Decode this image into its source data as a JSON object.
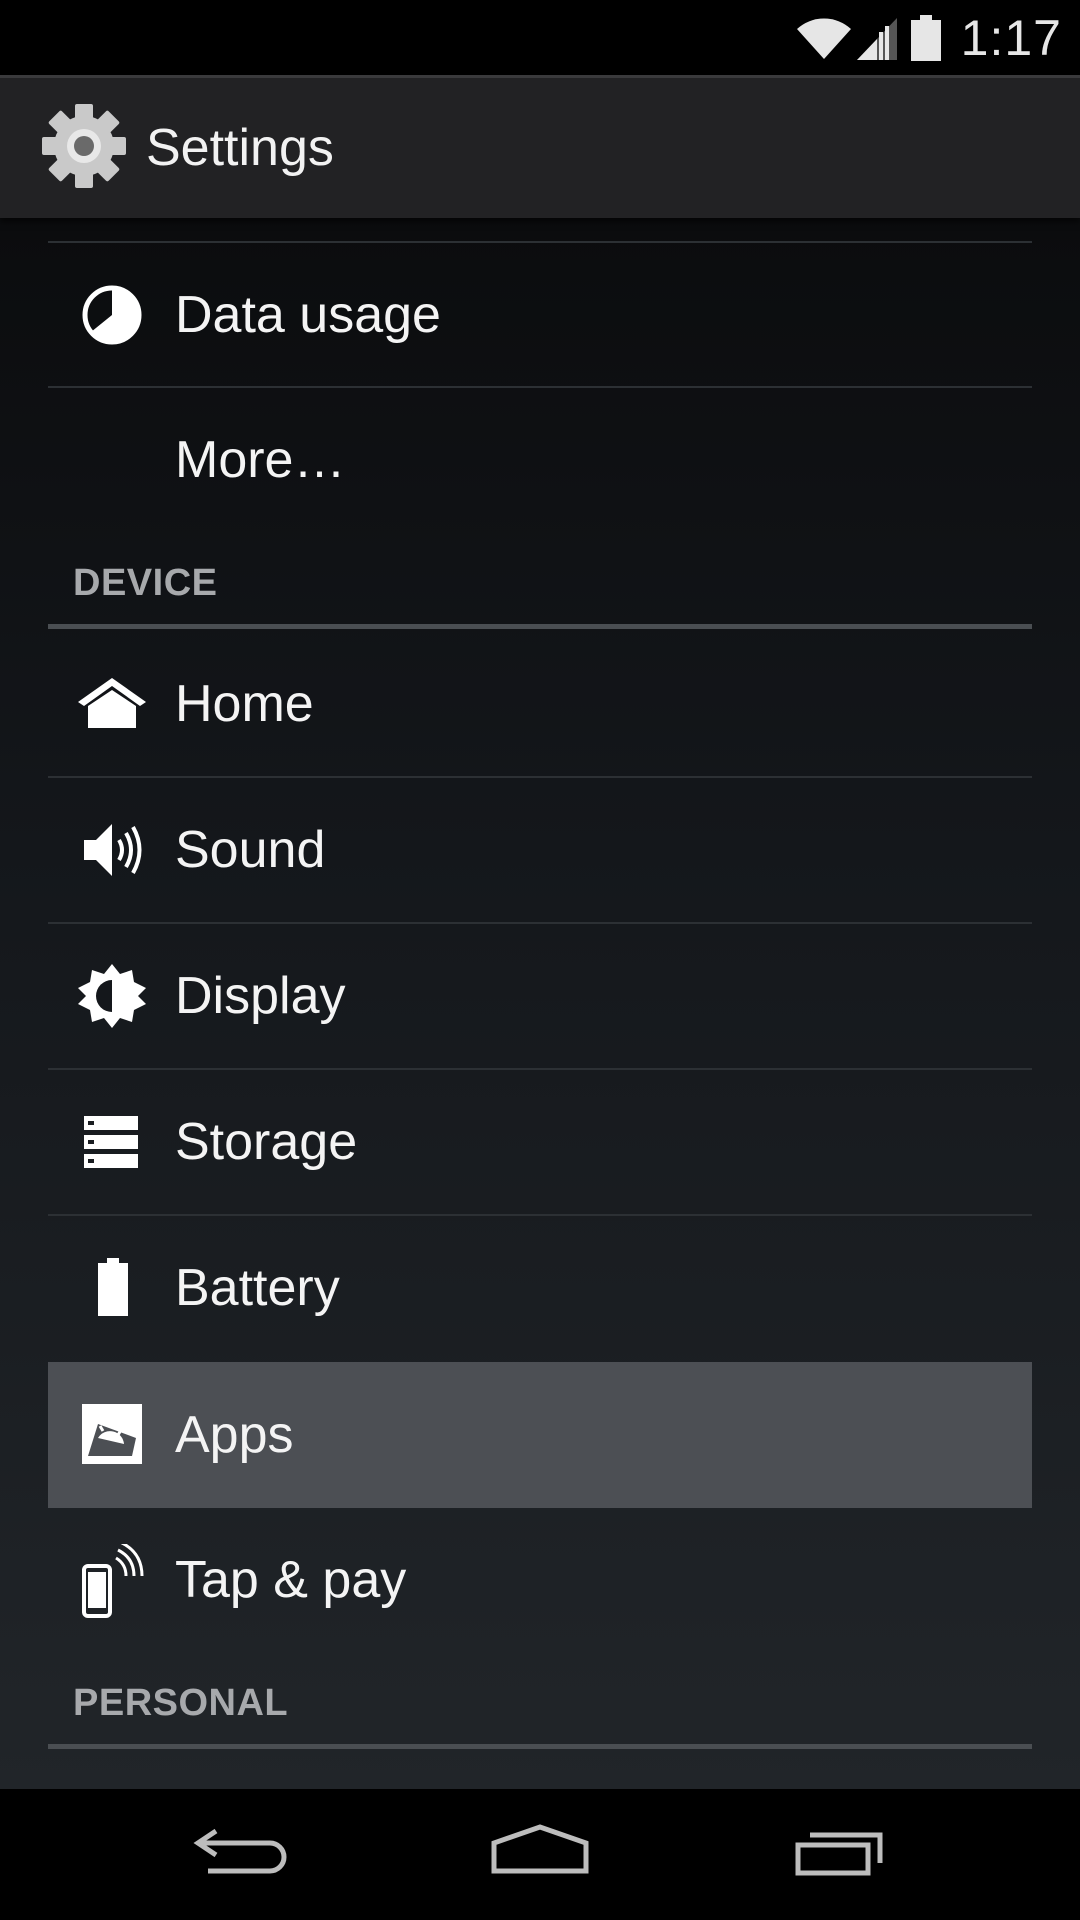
{
  "status_bar": {
    "time": "1:17",
    "icons": [
      "wifi-icon",
      "cell-signal-icon",
      "battery-icon"
    ]
  },
  "action_bar": {
    "title": "Settings",
    "icon": "gear-icon"
  },
  "sections": {
    "device": "DEVICE",
    "personal": "PERSONAL"
  },
  "items": {
    "data_usage": "Data usage",
    "more": "More…",
    "home": "Home",
    "sound": "Sound",
    "display": "Display",
    "storage": "Storage",
    "battery": "Battery",
    "apps": "Apps",
    "tap_pay": "Tap & pay"
  },
  "selected_item": "Apps",
  "colors": {
    "background_top": "#0b0c0e",
    "background_bottom": "#212529",
    "action_bar": "#222224",
    "selected_row": "#4c4f54",
    "section_header": "#a7a9ac"
  },
  "nav_bar": {
    "buttons": [
      "back-icon",
      "home-icon",
      "recent-apps-icon"
    ]
  }
}
